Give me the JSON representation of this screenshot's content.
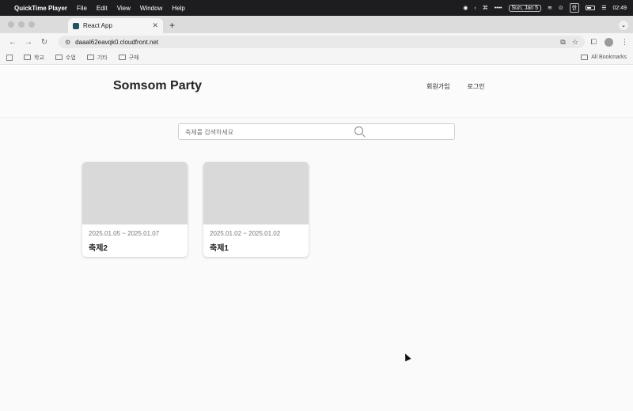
{
  "menubar": {
    "app_name": "QuickTime Player",
    "menus": [
      "File",
      "Edit",
      "View",
      "Window",
      "Help"
    ],
    "date": "Sun, Jan 5",
    "input_method": "한",
    "time": "02:49"
  },
  "browser": {
    "tab_title": "React App",
    "tab_close": "✕",
    "new_tab": "+",
    "url": "daaal62eavqk0.cloudfront.net",
    "bookmarks": [
      "학교",
      "수업",
      "기타",
      "구매"
    ],
    "all_bookmarks": "All Bookmarks"
  },
  "site": {
    "logo": "Somsom Party",
    "nav": {
      "signup": "회원가입",
      "login": "로그인"
    },
    "search_placeholder": "축제를 검색하세요"
  },
  "festivals": [
    {
      "dates": "2025.01.05 ~ 2025.01.07",
      "name": "축제2"
    },
    {
      "dates": "2025.01.02 ~ 2025.01.02",
      "name": "축제1"
    }
  ]
}
